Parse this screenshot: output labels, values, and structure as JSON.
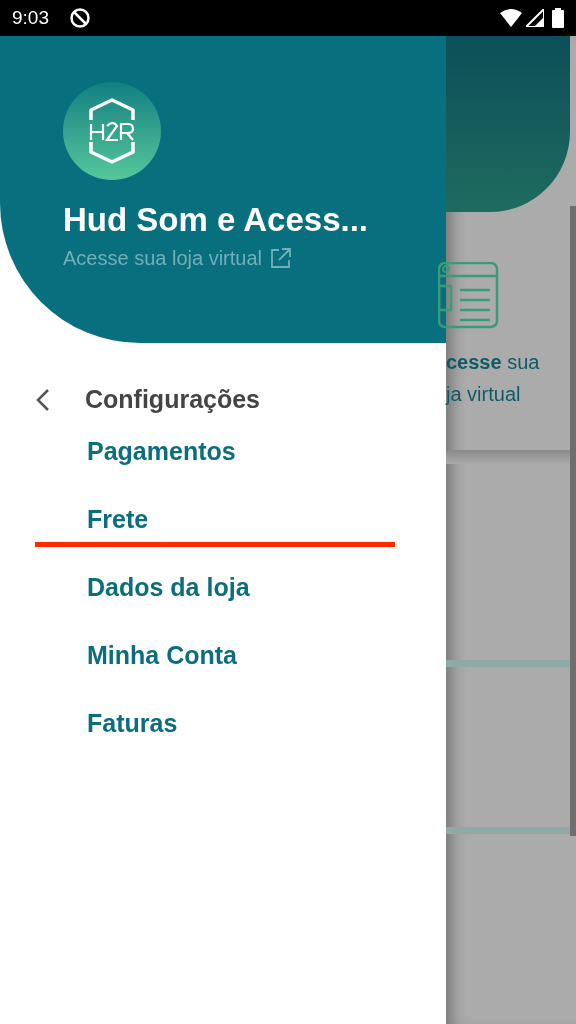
{
  "status_bar": {
    "time": "9:03"
  },
  "store": {
    "name": "Hud Som e Acess...",
    "link": "Acesse sua loja virtual"
  },
  "menu": {
    "title": "Configurações",
    "items": [
      {
        "label": "Pagamentos",
        "underlined": false
      },
      {
        "label": "Frete",
        "underlined": true
      },
      {
        "label": "Dados da loja",
        "underlined": false
      },
      {
        "label": "Minha Conta",
        "underlined": false
      },
      {
        "label": "Faturas",
        "underlined": false
      }
    ]
  },
  "background": {
    "card_lines": [
      "**cesse** sua",
      "ja virtual"
    ]
  }
}
